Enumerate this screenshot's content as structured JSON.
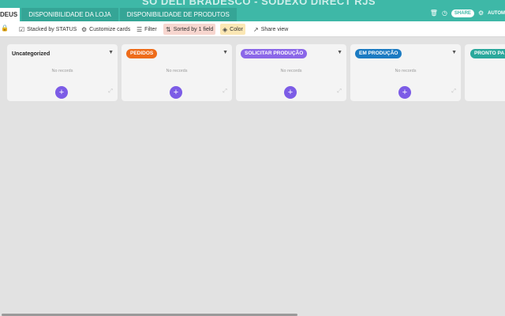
{
  "header": {
    "base_title": "SO DELI BRADESCO - SODEXO DIRECT RJS",
    "tabs": [
      {
        "label": "DEUS",
        "active": true
      },
      {
        "label": "DISPONIBILIDADE DA LOJA",
        "active": false
      },
      {
        "label": "DISPONIBILIDADE DE PRODUTOS",
        "active": false
      }
    ],
    "share_label": "SHARE",
    "automations_label": "AUTOM",
    "icons": [
      "trash-icon",
      "history-icon",
      "automation-icon"
    ]
  },
  "toolbar": {
    "stacked": "Stacked by STATUS",
    "customize": "Customize cards",
    "filter": "Filter",
    "sorted": "Sorted by 1 field",
    "color": "Color",
    "share_view": "Share view",
    "icons": [
      "lock-icon",
      "checkbox-icon",
      "gear-icon",
      "filter-icon",
      "sort-icon",
      "paint-bucket-icon",
      "share-arrow-icon"
    ]
  },
  "columns": [
    {
      "name": "Uncategorized",
      "color": "",
      "empty_text": "No records"
    },
    {
      "name": "PEDIDOS",
      "color": "#ee6c1a",
      "empty_text": "No records"
    },
    {
      "name": "SOLICITAR PRODUÇÃO",
      "color": "#8b67e8",
      "empty_text": "No records"
    },
    {
      "name": "EM PRODUÇÃO",
      "color": "#1b7bc2",
      "empty_text": "No records"
    },
    {
      "name": "PRONTO PA",
      "color": "#2aa89c",
      "empty_text": ""
    }
  ],
  "colors": {
    "header_bg": "#3eb8a7",
    "tab_bg": "#35a596",
    "add_button": "#7c5ce6",
    "canvas_bg": "#e2e2e2"
  }
}
